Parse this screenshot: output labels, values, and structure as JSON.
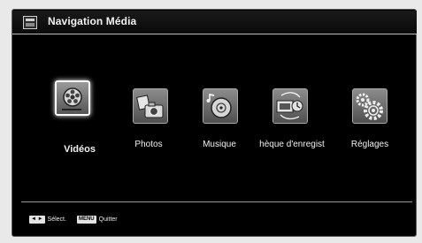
{
  "header": {
    "title": "Navigation Média",
    "icon": "media-browser-icon"
  },
  "menu": {
    "items": [
      {
        "label": "Vidéos",
        "icon": "film-reel-icon",
        "selected": true
      },
      {
        "label": "Photos",
        "icon": "camera-photos-icon",
        "selected": false
      },
      {
        "label": "Musique",
        "icon": "music-disc-icon",
        "selected": false
      },
      {
        "label": "hèque d'enregist",
        "icon": "recording-library-icon",
        "selected": false
      },
      {
        "label": "Réglages",
        "icon": "settings-gears-icon",
        "selected": false
      }
    ]
  },
  "footer": {
    "arrows_key": "◄ ►",
    "select_label": "Sélect.",
    "menu_key": "MENU",
    "quit_label": "Quitter"
  }
}
